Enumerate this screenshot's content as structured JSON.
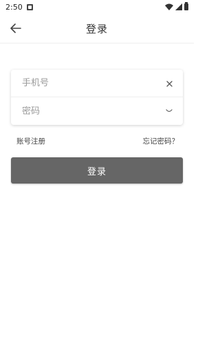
{
  "status_bar": {
    "time": "2:50"
  },
  "app_bar": {
    "title": "登录"
  },
  "form": {
    "phone_placeholder": "手机号",
    "phone_value": "",
    "password_placeholder": "密码",
    "password_value": ""
  },
  "links": {
    "register": "账号注册",
    "forgot_password": "忘记密码？"
  },
  "login_button": {
    "label": "登录",
    "color": "#666666"
  },
  "icons": {
    "back": "arrow-left-icon",
    "clear": "close-icon",
    "password_toggle": "eye-closed-icon"
  }
}
